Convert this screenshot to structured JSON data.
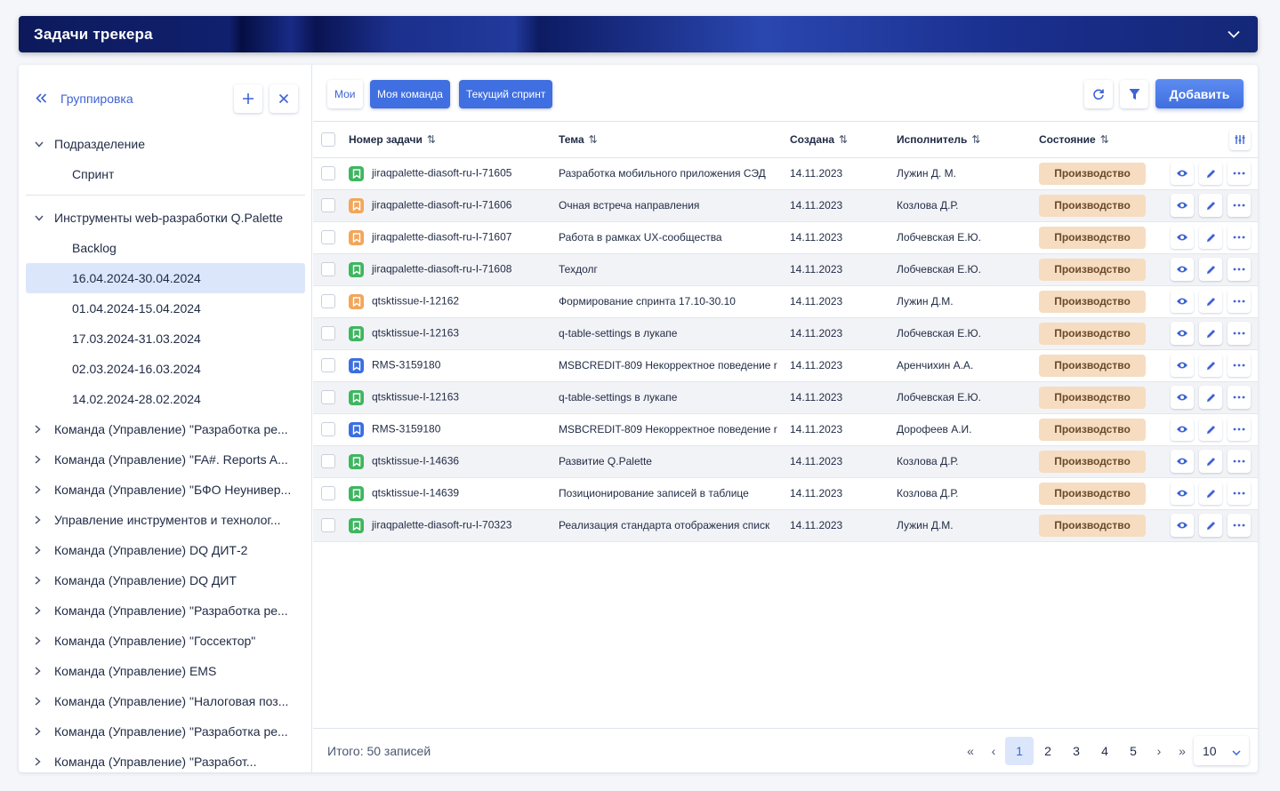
{
  "window": {
    "title": "Задачи трекера"
  },
  "sidebar": {
    "header_label": "Группировка",
    "nodes": [
      {
        "label": "Подразделение",
        "expanded": true
      },
      {
        "label": "Спринт"
      },
      {
        "label": "Инструменты web-разработки Q.Palette",
        "expanded": true
      },
      {
        "label": "Backlog"
      },
      {
        "label": "16.04.2024-30.04.2024",
        "selected": true
      },
      {
        "label": "01.04.2024-15.04.2024"
      },
      {
        "label": "17.03.2024-31.03.2024"
      },
      {
        "label": "02.03.2024-16.03.2024"
      },
      {
        "label": "14.02.2024-28.02.2024"
      },
      {
        "label": "Команда (Управление) \"Разработка ре..."
      },
      {
        "label": "Команда (Управление) \"FA#. Reports A..."
      },
      {
        "label": "Команда (Управление) \"БФО Неунивер..."
      },
      {
        "label": "Управление инструментов и технолог..."
      },
      {
        "label": "Команда (Управление) DQ ДИТ-2"
      },
      {
        "label": "Команда (Управление) DQ ДИТ"
      },
      {
        "label": "Команда (Управление) \"Разработка ре..."
      },
      {
        "label": "Команда (Управление) \"Госсектор\""
      },
      {
        "label": "Команда (Управление) EMS"
      },
      {
        "label": "Команда (Управление) \"Налоговая поз..."
      },
      {
        "label": "Команда (Управление) \"Разработка ре..."
      },
      {
        "label": "Команда (Управление) \"Разработ..."
      }
    ]
  },
  "toolbar": {
    "filters": [
      "Мои",
      "Моя команда",
      "Текущий спринт"
    ],
    "add_label": "Добавить"
  },
  "table": {
    "columns": [
      "Номер задачи",
      "Тема",
      "Создана",
      "Исполнитель",
      "Состояние"
    ],
    "rows": [
      {
        "id": "jiraqpalette-diasoft-ru-I-71605",
        "topic": "Разработка мобильного приложения СЭД",
        "created": "14.11.2023",
        "assignee": "Лужин Д. М.",
        "status": "Производство",
        "tag": "green"
      },
      {
        "id": "jiraqpalette-diasoft-ru-I-71606",
        "topic": "Очная встреча направления",
        "created": "14.11.2023",
        "assignee": "Козлова Д.Р.",
        "status": "Производство",
        "tag": "orange"
      },
      {
        "id": "jiraqpalette-diasoft-ru-I-71607",
        "topic": "Работа в рамках UX-сообщества",
        "created": "14.11.2023",
        "assignee": "Лобчевская Е.Ю.",
        "status": "Производство",
        "tag": "orange"
      },
      {
        "id": "jiraqpalette-diasoft-ru-I-71608",
        "topic": "Техдолг",
        "created": "14.11.2023",
        "assignee": "Лобчевская Е.Ю.",
        "status": "Производство",
        "tag": "green"
      },
      {
        "id": "qtsktissue-I-12162",
        "topic": "Формирование спринта 17.10-30.10",
        "created": "14.11.2023",
        "assignee": "Лужин Д.М.",
        "status": "Производство",
        "tag": "orange"
      },
      {
        "id": "qtsktissue-I-12163",
        "topic": "q-table-settings в лукапе",
        "created": "14.11.2023",
        "assignee": "Лобчевская Е.Ю.",
        "status": "Производство",
        "tag": "green"
      },
      {
        "id": "RMS-3159180",
        "topic": "MSBCREDIT-809 Некорректное поведение r",
        "created": "14.11.2023",
        "assignee": "Аренчихин А.А.",
        "status": "Производство",
        "tag": "blue"
      },
      {
        "id": "qtsktissue-I-12163",
        "topic": "q-table-settings в лукапе",
        "created": "14.11.2023",
        "assignee": "Лобчевская Е.Ю.",
        "status": "Производство",
        "tag": "green"
      },
      {
        "id": "RMS-3159180",
        "topic": "MSBCREDIT-809 Некорректное поведение r",
        "created": "14.11.2023",
        "assignee": "Дорофеев А.И.",
        "status": "Производство",
        "tag": "blue"
      },
      {
        "id": "qtsktissue-I-14636",
        "topic": "Развитие Q.Palette",
        "created": "14.11.2023",
        "assignee": "Козлова Д.Р.",
        "status": "Производство",
        "tag": "green"
      },
      {
        "id": "qtsktissue-I-14639",
        "topic": "Позиционирование записей в таблице",
        "created": "14.11.2023",
        "assignee": "Козлова Д.Р.",
        "status": "Производство",
        "tag": "green"
      },
      {
        "id": "jiraqpalette-diasoft-ru-I-70323",
        "topic": "Реализация стандарта отображения списк",
        "created": "14.11.2023",
        "assignee": "Лужин Д.М.",
        "status": "Производство",
        "tag": "green"
      }
    ]
  },
  "footer": {
    "total": "Итого: 50 записей",
    "pages": [
      "1",
      "2",
      "3",
      "4",
      "5"
    ],
    "current_page": "1",
    "first": "«",
    "prev": "‹",
    "next": "›",
    "last": "»",
    "page_size": "10"
  },
  "colors": {
    "accent": "#3f6fe0",
    "status_bg": "#f6dcc0",
    "tag_green": "#3fb660",
    "tag_orange": "#f3a65a",
    "tag_blue": "#3b6fe0"
  }
}
